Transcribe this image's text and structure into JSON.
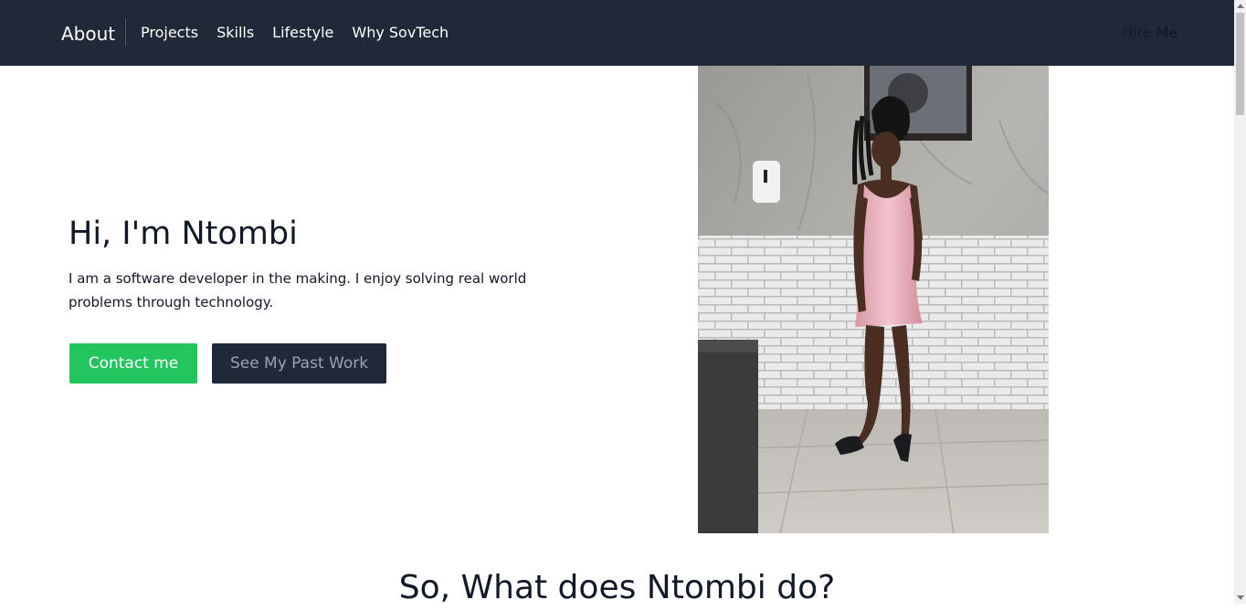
{
  "nav": {
    "brand": "About",
    "links": [
      "Projects",
      "Skills",
      "Lifestyle",
      "Why SovTech"
    ],
    "cta": "Hire Me"
  },
  "hero": {
    "title": "Hi, I'm Ntombi",
    "text": "I am a software developer in the making. I enjoy solving real world problems through technology.",
    "primary_button": "Contact me",
    "secondary_button": "See My Past Work"
  },
  "section": {
    "title": "So, What does Ntombi do?"
  },
  "colors": {
    "nav_bg": "#1f2937",
    "primary": "#22c55e",
    "secondary": "#1f2937"
  }
}
